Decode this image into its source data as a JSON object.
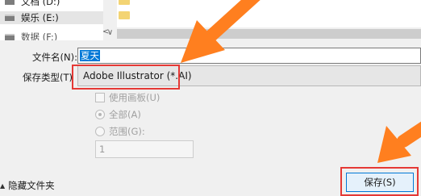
{
  "nav": {
    "drives": [
      {
        "label": "文档 (D:)"
      },
      {
        "label": "娱乐 (E:)"
      },
      {
        "label": "数据 (F:)"
      }
    ]
  },
  "form": {
    "filename_label": "文件名(N):",
    "filename_value": "夏天",
    "filetype_label": "保存类型(T)",
    "filetype_value": "Adobe Illustrator (*.AI)"
  },
  "options": {
    "use_artboards": "使用画板(U)",
    "all": "全部(A)",
    "range": "范围(G):",
    "range_value": "1"
  },
  "footer": {
    "hide_folders": "隐藏文件夹",
    "save_button": "保存(S)"
  },
  "colors": {
    "highlight_box": "#e53935",
    "arrow": "#ff7f1f",
    "selection": "#0078d7"
  }
}
